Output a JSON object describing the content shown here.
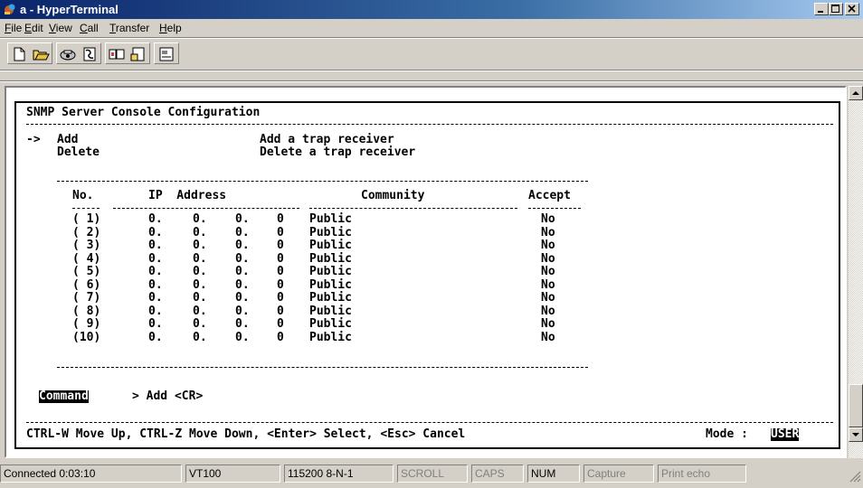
{
  "window": {
    "title": "a - HyperTerminal"
  },
  "menu": [
    {
      "pre": "",
      "u": "F",
      "post": "ile"
    },
    {
      "pre": "",
      "u": "E",
      "post": "dit"
    },
    {
      "pre": "",
      "u": "V",
      "post": "iew"
    },
    {
      "pre": "",
      "u": "C",
      "post": "all"
    },
    {
      "pre": "",
      "u": "T",
      "post": "ransfer"
    },
    {
      "pre": "",
      "u": "H",
      "post": "elp"
    }
  ],
  "toolbar": {
    "buttons": [
      "new-icon",
      "open-icon",
      "connect-icon",
      "disconnect-icon",
      "send-icon",
      "receive-icon",
      "properties-icon"
    ]
  },
  "terminal": {
    "title": "SNMP Server Console Configuration",
    "menu": [
      {
        "cursor": "->",
        "label": "Add",
        "desc": "Add a trap receiver"
      },
      {
        "cursor": "",
        "label": "Delete",
        "desc": "Delete a trap receiver"
      }
    ],
    "table": {
      "headers": {
        "no": "No.",
        "ip": "IP  Address",
        "community": "Community",
        "accept": "Accept"
      },
      "rows": [
        {
          "no": "( 1)",
          "ip": [
            "0.",
            "0.",
            "0.",
            "0"
          ],
          "community": "Public",
          "accept": "No"
        },
        {
          "no": "( 2)",
          "ip": [
            "0.",
            "0.",
            "0.",
            "0"
          ],
          "community": "Public",
          "accept": "No"
        },
        {
          "no": "( 3)",
          "ip": [
            "0.",
            "0.",
            "0.",
            "0"
          ],
          "community": "Public",
          "accept": "No"
        },
        {
          "no": "( 4)",
          "ip": [
            "0.",
            "0.",
            "0.",
            "0"
          ],
          "community": "Public",
          "accept": "No"
        },
        {
          "no": "( 5)",
          "ip": [
            "0.",
            "0.",
            "0.",
            "0"
          ],
          "community": "Public",
          "accept": "No"
        },
        {
          "no": "( 6)",
          "ip": [
            "0.",
            "0.",
            "0.",
            "0"
          ],
          "community": "Public",
          "accept": "No"
        },
        {
          "no": "( 7)",
          "ip": [
            "0.",
            "0.",
            "0.",
            "0"
          ],
          "community": "Public",
          "accept": "No"
        },
        {
          "no": "( 8)",
          "ip": [
            "0.",
            "0.",
            "0.",
            "0"
          ],
          "community": "Public",
          "accept": "No"
        },
        {
          "no": "( 9)",
          "ip": [
            "0.",
            "0.",
            "0.",
            "0"
          ],
          "community": "Public",
          "accept": "No"
        },
        {
          "no": "(10)",
          "ip": [
            "0.",
            "0.",
            "0.",
            "0"
          ],
          "community": "Public",
          "accept": "No"
        }
      ]
    },
    "command": {
      "label": "Command",
      "value": "> Add <CR>"
    },
    "help": {
      "text": "CTRL-W Move Up, CTRL-Z Move Down, <Enter> Select, <Esc> Cancel",
      "mode_label": "Mode :",
      "mode_value": "USER"
    }
  },
  "statusbar": [
    {
      "text": "Connected 0:03:10",
      "active": true
    },
    {
      "text": "VT100",
      "active": true
    },
    {
      "text": "115200 8-N-1",
      "active": true
    },
    {
      "text": "SCROLL",
      "active": false
    },
    {
      "text": "CAPS",
      "active": false
    },
    {
      "text": "NUM",
      "active": true
    },
    {
      "text": "Capture",
      "active": false
    },
    {
      "text": "Print echo",
      "active": false
    }
  ],
  "colors": {
    "titlebar_start": "#0a246a",
    "titlebar_end": "#a6caf0",
    "chrome": "#d4d0c8",
    "terminal_bg": "#ffffff",
    "terminal_fg": "#000000"
  }
}
